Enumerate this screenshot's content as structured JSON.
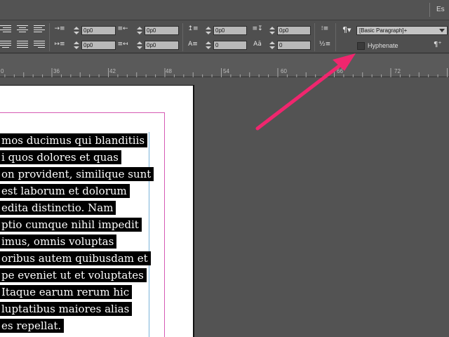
{
  "topbar": {
    "right_label": "Es"
  },
  "paragraph_panel": {
    "left_indent": "0p0",
    "right_indent": "0p0",
    "first_line_indent": "0p0",
    "last_line_indent": "0p0",
    "space_before": "0p0",
    "space_after": "0p0",
    "drop_cap_lines": "0",
    "drop_cap_chars": "0",
    "paragraph_style": "[Basic Paragraph]+",
    "hyphenate_label": "Hyphenate",
    "hyphenate_checked": false
  },
  "ruler": {
    "marks": [
      "0",
      "36",
      "42",
      "48",
      "54",
      "60",
      "66",
      "72"
    ]
  },
  "document": {
    "lines": [
      "mos ducimus qui blanditiis",
      "i quos dolores et quas",
      "on provident, similique sunt",
      "est laborum et dolorum",
      "edita distinctio. Nam",
      "ptio cumque nihil impedit",
      "imus, omnis voluptas",
      "oribus autem quibusdam et",
      "pe eveniet ut et voluptates",
      "Itaque earum rerum hic",
      "luptatibus maiores alias",
      "es repellat."
    ]
  },
  "colors": {
    "annotation_arrow": "#f0266e",
    "margin_guide": "#d65ab4",
    "frame_guide": "#7ab2d9",
    "selection": "#000000"
  }
}
